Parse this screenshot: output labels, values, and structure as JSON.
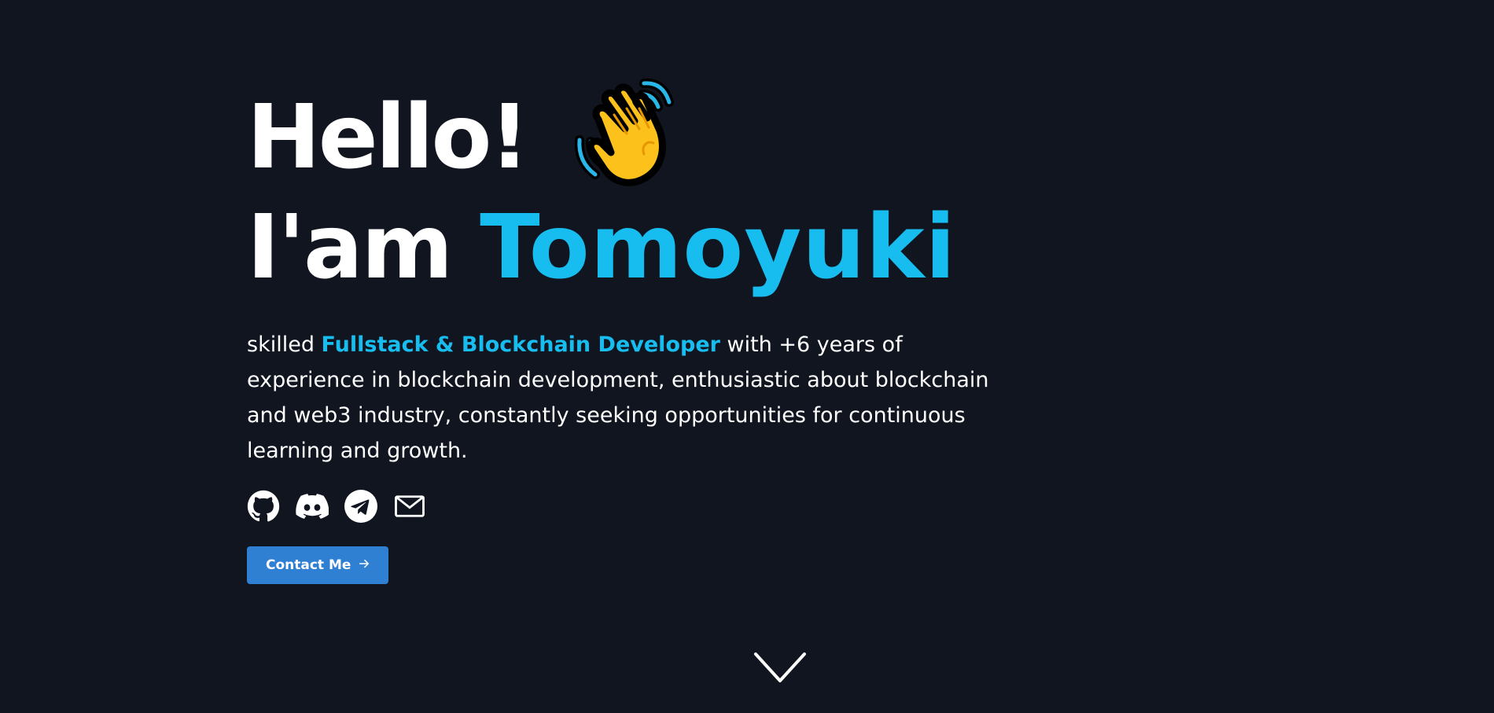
{
  "hero": {
    "greeting": "Hello!",
    "wave_icon": "waving-hand-emoji",
    "intro_prefix": "I'am",
    "name": "Tomoyuki",
    "bio_prefix": "skilled ",
    "bio_role": "Fullstack & Blockchain Developer",
    "bio_suffix": " with +6 years of experience in blockchain development, enthusiastic about blockchain and web3 industry, constantly seeking opportunities for continuous learning and growth."
  },
  "socials": [
    {
      "icon": "github-icon"
    },
    {
      "icon": "discord-icon"
    },
    {
      "icon": "telegram-icon"
    },
    {
      "icon": "mail-icon"
    }
  ],
  "contact": {
    "label": "Contact Me",
    "icon": "arrow-right-icon"
  },
  "scroll": {
    "icon": "chevron-down-icon"
  },
  "colors": {
    "background": "#111520",
    "accent": "#18bdef",
    "button": "#2f7fd3",
    "text": "#ffffff"
  }
}
